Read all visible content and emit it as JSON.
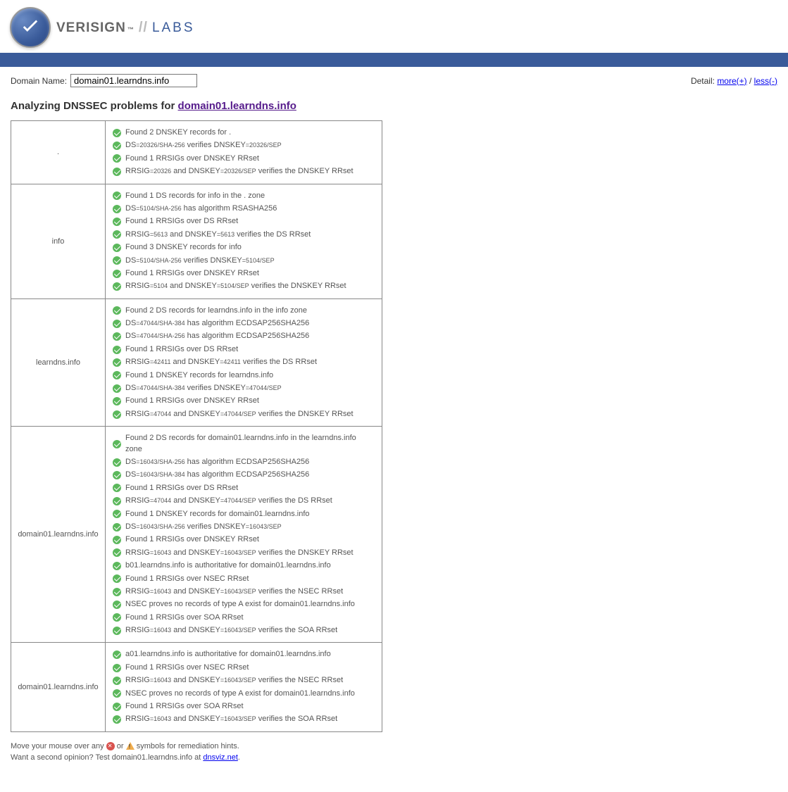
{
  "brand": {
    "name": "VERISIGN",
    "tm": "™",
    "sep": "//",
    "labs": "LABS"
  },
  "controls": {
    "domain_label": "Domain Name:",
    "domain_value": "domain01.learndns.info",
    "detail_label": "Detail:",
    "more": "more(+)",
    "sep": " / ",
    "less": "less(-)"
  },
  "heading": {
    "prefix": "Analyzing DNSSEC problems for ",
    "link": "domain01.learndns.info"
  },
  "zones": [
    {
      "name": ".",
      "items": [
        {
          "parts": [
            "Found 2 DNSKEY records for ."
          ]
        },
        {
          "parts": [
            "DS",
            {
              "small": "=20326/SHA-256"
            },
            " verifies DNSKEY",
            {
              "small": "=20326/SEP"
            }
          ]
        },
        {
          "parts": [
            "Found 1 RRSIGs over DNSKEY RRset"
          ]
        },
        {
          "parts": [
            "RRSIG",
            {
              "small": "=20326"
            },
            " and DNSKEY",
            {
              "small": "=20326/SEP"
            },
            " verifies the DNSKEY RRset"
          ]
        }
      ]
    },
    {
      "name": "info",
      "items": [
        {
          "parts": [
            "Found 1 DS records for info in the . zone"
          ]
        },
        {
          "parts": [
            "DS",
            {
              "small": "=5104/SHA-256"
            },
            " has algorithm RSASHA256"
          ]
        },
        {
          "parts": [
            "Found 1 RRSIGs over DS RRset"
          ]
        },
        {
          "parts": [
            "RRSIG",
            {
              "small": "=5613"
            },
            " and DNSKEY",
            {
              "small": "=5613"
            },
            " verifies the DS RRset"
          ]
        },
        {
          "parts": [
            "Found 3 DNSKEY records for info"
          ]
        },
        {
          "parts": [
            "DS",
            {
              "small": "=5104/SHA-256"
            },
            " verifies DNSKEY",
            {
              "small": "=5104/SEP"
            }
          ]
        },
        {
          "parts": [
            "Found 1 RRSIGs over DNSKEY RRset"
          ]
        },
        {
          "parts": [
            "RRSIG",
            {
              "small": "=5104"
            },
            " and DNSKEY",
            {
              "small": "=5104/SEP"
            },
            " verifies the DNSKEY RRset"
          ]
        }
      ]
    },
    {
      "name": "learndns.info",
      "items": [
        {
          "parts": [
            "Found 2 DS records for learndns.info in the info zone"
          ]
        },
        {
          "parts": [
            "DS",
            {
              "small": "=47044/SHA-384"
            },
            " has algorithm ECDSAP256SHA256"
          ]
        },
        {
          "parts": [
            "DS",
            {
              "small": "=47044/SHA-256"
            },
            " has algorithm ECDSAP256SHA256"
          ]
        },
        {
          "parts": [
            "Found 1 RRSIGs over DS RRset"
          ]
        },
        {
          "parts": [
            "RRSIG",
            {
              "small": "=42411"
            },
            " and DNSKEY",
            {
              "small": "=42411"
            },
            " verifies the DS RRset"
          ]
        },
        {
          "parts": [
            "Found 1 DNSKEY records for learndns.info"
          ]
        },
        {
          "parts": [
            "DS",
            {
              "small": "=47044/SHA-384"
            },
            " verifies DNSKEY",
            {
              "small": "=47044/SEP"
            }
          ]
        },
        {
          "parts": [
            "Found 1 RRSIGs over DNSKEY RRset"
          ]
        },
        {
          "parts": [
            "RRSIG",
            {
              "small": "=47044"
            },
            " and DNSKEY",
            {
              "small": "=47044/SEP"
            },
            " verifies the DNSKEY RRset"
          ]
        }
      ]
    },
    {
      "name": "domain01.learndns.info",
      "items": [
        {
          "parts": [
            "Found 2 DS records for domain01.learndns.info in the learndns.info zone"
          ]
        },
        {
          "parts": [
            "DS",
            {
              "small": "=16043/SHA-256"
            },
            " has algorithm ECDSAP256SHA256"
          ]
        },
        {
          "parts": [
            "DS",
            {
              "small": "=16043/SHA-384"
            },
            " has algorithm ECDSAP256SHA256"
          ]
        },
        {
          "parts": [
            "Found 1 RRSIGs over DS RRset"
          ]
        },
        {
          "parts": [
            "RRSIG",
            {
              "small": "=47044"
            },
            " and DNSKEY",
            {
              "small": "=47044/SEP"
            },
            " verifies the DS RRset"
          ]
        },
        {
          "parts": [
            "Found 1 DNSKEY records for domain01.learndns.info"
          ]
        },
        {
          "parts": [
            "DS",
            {
              "small": "=16043/SHA-256"
            },
            " verifies DNSKEY",
            {
              "small": "=16043/SEP"
            }
          ]
        },
        {
          "parts": [
            "Found 1 RRSIGs over DNSKEY RRset"
          ]
        },
        {
          "parts": [
            "RRSIG",
            {
              "small": "=16043"
            },
            " and DNSKEY",
            {
              "small": "=16043/SEP"
            },
            " verifies the DNSKEY RRset"
          ]
        },
        {
          "parts": [
            "b01.learndns.info is authoritative for domain01.learndns.info"
          ]
        },
        {
          "parts": [
            "Found 1 RRSIGs over NSEC RRset"
          ]
        },
        {
          "parts": [
            "RRSIG",
            {
              "small": "=16043"
            },
            " and DNSKEY",
            {
              "small": "=16043/SEP"
            },
            " verifies the NSEC RRset"
          ]
        },
        {
          "parts": [
            "NSEC proves no records of type A exist for domain01.learndns.info"
          ]
        },
        {
          "parts": [
            "Found 1 RRSIGs over SOA RRset"
          ]
        },
        {
          "parts": [
            "RRSIG",
            {
              "small": "=16043"
            },
            " and DNSKEY",
            {
              "small": "=16043/SEP"
            },
            " verifies the SOA RRset"
          ]
        }
      ]
    },
    {
      "name": "domain01.learndns.info",
      "items": [
        {
          "parts": [
            "a01.learndns.info is authoritative for domain01.learndns.info"
          ]
        },
        {
          "parts": [
            "Found 1 RRSIGs over NSEC RRset"
          ]
        },
        {
          "parts": [
            "RRSIG",
            {
              "small": "=16043"
            },
            " and DNSKEY",
            {
              "small": "=16043/SEP"
            },
            " verifies the NSEC RRset"
          ]
        },
        {
          "parts": [
            "NSEC proves no records of type A exist for domain01.learndns.info"
          ]
        },
        {
          "parts": [
            "Found 1 RRSIGs over SOA RRset"
          ]
        },
        {
          "parts": [
            "RRSIG",
            {
              "small": "=16043"
            },
            " and DNSKEY",
            {
              "small": "=16043/SEP"
            },
            " verifies the SOA RRset"
          ]
        }
      ]
    }
  ],
  "footer": {
    "hint_pre": "Move your mouse over any ",
    "hint_mid": " or ",
    "hint_post": " symbols for remediation hints.",
    "opinion_pre": "Want a second opinion? Test domain01.learndns.info at ",
    "opinion_link": "dnsviz.net",
    "opinion_post": "."
  }
}
